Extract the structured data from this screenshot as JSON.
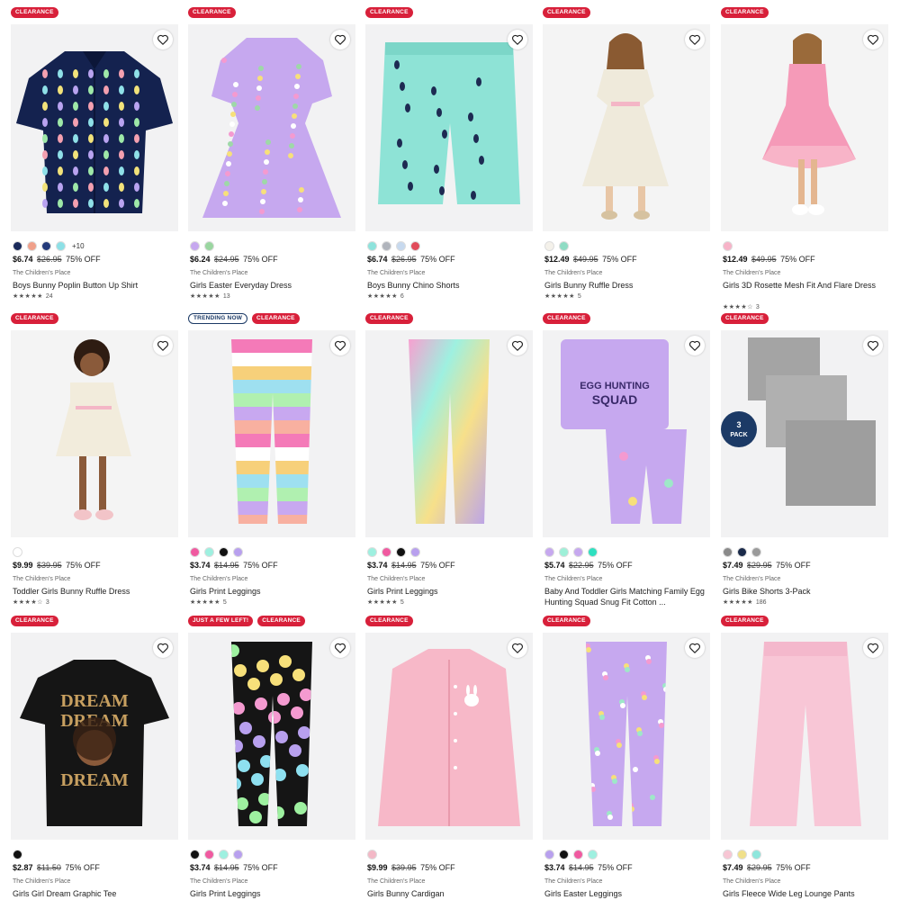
{
  "products": [
    {
      "badges": [
        {
          "type": "clearance",
          "label": "CLEARANCE"
        }
      ],
      "swatches": [
        "#1a2a5a",
        "#f0a08a",
        "#233a7a",
        "#8de0e6"
      ],
      "more": "+10",
      "price": "$6.74",
      "was": "$26.95",
      "off": "75% OFF",
      "brand": "The Children's Place",
      "name": "Boys Bunny Poplin Button Up Shirt",
      "stars": "★★★★★",
      "reviews": "24",
      "image": "navy-bunny-shirt"
    },
    {
      "badges": [
        {
          "type": "clearance",
          "label": "CLEARANCE"
        }
      ],
      "swatches": [
        "#c6a8ef",
        "#9ad6a0"
      ],
      "more": "",
      "price": "$6.24",
      "was": "$24.95",
      "off": "75% OFF",
      "brand": "The Children's Place",
      "name": "Girls Easter Everyday Dress",
      "stars": "★★★★★",
      "reviews": "13",
      "image": "lavender-easter-dress"
    },
    {
      "badges": [
        {
          "type": "clearance",
          "label": "CLEARANCE"
        }
      ],
      "swatches": [
        "#8ee3dc",
        "#b0b4bc",
        "#c7d9ee",
        "#e14b5a"
      ],
      "more": "",
      "price": "$6.74",
      "was": "$26.95",
      "off": "75% OFF",
      "brand": "The Children's Place",
      "name": "Boys Bunny Chino Shorts",
      "stars": "★★★★★",
      "reviews": "6",
      "image": "mint-bunny-shorts"
    },
    {
      "badges": [
        {
          "type": "clearance",
          "label": "CLEARANCE"
        }
      ],
      "swatches": [
        "#f4f1ea",
        "#8fdcc4"
      ],
      "more": "",
      "price": "$12.49",
      "was": "$49.95",
      "off": "75% OFF",
      "brand": "The Children's Place",
      "name": "Girls Bunny Ruffle Dress",
      "stars": "★★★★★",
      "reviews": "5",
      "image": "bunny-ruffle-dress"
    },
    {
      "badges": [
        {
          "type": "clearance",
          "label": "CLEARANCE"
        }
      ],
      "swatches": [
        "#f7b3c8"
      ],
      "more": "",
      "price": "$12.49",
      "was": "$49.95",
      "off": "75% OFF",
      "brand": "The Children's Place",
      "name": "Girls 3D Rosette Mesh Fit And Flare Dress",
      "stars": "★★★★☆",
      "reviews": "3",
      "image": "pink-rosette-dress"
    },
    {
      "badges": [
        {
          "type": "clearance",
          "label": "CLEARANCE"
        }
      ],
      "swatches": [
        "#ffffff"
      ],
      "more": "",
      "price": "$9.99",
      "was": "$39.95",
      "off": "75% OFF",
      "brand": "The Children's Place",
      "name": "Toddler Girls Bunny Ruffle Dress",
      "stars": "★★★★☆",
      "reviews": "3",
      "image": "toddler-ruffle-dress"
    },
    {
      "badges": [
        {
          "type": "trending",
          "label": "TRENDING NOW"
        },
        {
          "type": "clearance",
          "label": "CLEARANCE"
        }
      ],
      "swatches": [
        "#f05aa0",
        "#9ef0e0",
        "#111111",
        "#b8a0ee"
      ],
      "more": "",
      "price": "$3.74",
      "was": "$14.95",
      "off": "75% OFF",
      "brand": "The Children's Place",
      "name": "Girls Print Leggings",
      "stars": "★★★★★",
      "reviews": "5",
      "image": "rainbow-stripe-leggings"
    },
    {
      "badges": [
        {
          "type": "clearance",
          "label": "CLEARANCE"
        }
      ],
      "swatches": [
        "#9ef0e0",
        "#f05aa0",
        "#111111",
        "#b8a0ee"
      ],
      "more": "",
      "price": "$3.74",
      "was": "$14.95",
      "off": "75% OFF",
      "brand": "The Children's Place",
      "name": "Girls Print Leggings",
      "stars": "★★★★★",
      "reviews": "5",
      "image": "tie-dye-leggings"
    },
    {
      "badges": [
        {
          "type": "clearance",
          "label": "CLEARANCE"
        }
      ],
      "swatches": [
        "#c6a8ef",
        "#9ef0d8",
        "#c6a8ef",
        "#2ee0c0"
      ],
      "more": "",
      "price": "$5.74",
      "was": "$22.95",
      "off": "75% OFF",
      "brand": "The Children's Place",
      "name": "Baby And Toddler Girls Matching Family Egg Hunting Squad Snug Fit Cotton ...",
      "stars": "",
      "reviews": "",
      "image": "egg-hunting-pajamas"
    },
    {
      "badges": [
        {
          "type": "clearance",
          "label": "CLEARANCE"
        }
      ],
      "swatches": [
        "#8a8a8a",
        "#1a2a4a",
        "#9a9a9a"
      ],
      "more": "",
      "price": "$7.49",
      "was": "$29.95",
      "off": "75% OFF",
      "brand": "The Children's Place",
      "name": "Girls Bike Shorts 3-Pack",
      "stars": "★★★★★",
      "reviews": "186",
      "image": "gray-bike-shorts",
      "pack": "3 PACK"
    },
    {
      "badges": [
        {
          "type": "clearance",
          "label": "CLEARANCE"
        }
      ],
      "swatches": [
        "#111111"
      ],
      "more": "",
      "price": "$2.87",
      "was": "$11.50",
      "off": "75% OFF",
      "brand": "The Children's Place",
      "name": "Girls Girl Dream Graphic Tee",
      "stars": "",
      "reviews": "",
      "image": "dream-tee",
      "tee_text": "DREAM"
    },
    {
      "badges": [
        {
          "type": "fewleft",
          "label": "JUST A FEW LEFT!"
        },
        {
          "type": "clearance",
          "label": "CLEARANCE"
        }
      ],
      "swatches": [
        "#111111",
        "#f05aa0",
        "#9ef0e0",
        "#b8a0ee"
      ],
      "more": "",
      "price": "$3.74",
      "was": "$14.95",
      "off": "75% OFF",
      "brand": "The Children's Place",
      "name": "Girls Print Leggings",
      "stars": "",
      "reviews": "",
      "image": "peace-smiley-leggings"
    },
    {
      "badges": [
        {
          "type": "clearance",
          "label": "CLEARANCE"
        }
      ],
      "swatches": [
        "#f3b8c6"
      ],
      "more": "",
      "price": "$9.99",
      "was": "$39.95",
      "off": "75% OFF",
      "brand": "The Children's Place",
      "name": "Girls Bunny Cardigan",
      "stars": "",
      "reviews": "",
      "image": "pink-cardigan"
    },
    {
      "badges": [
        {
          "type": "clearance",
          "label": "CLEARANCE"
        }
      ],
      "swatches": [
        "#b8a0ee",
        "#111111",
        "#f05aa0",
        "#9ef0e0"
      ],
      "more": "",
      "price": "$3.74",
      "was": "$14.95",
      "off": "75% OFF",
      "brand": "The Children's Place",
      "name": "Girls Easter Leggings",
      "stars": "",
      "reviews": "",
      "image": "easter-leggings"
    },
    {
      "badges": [
        {
          "type": "clearance",
          "label": "CLEARANCE"
        }
      ],
      "swatches": [
        "#f7c6d4",
        "#f0e08a",
        "#8ee6dc"
      ],
      "more": "",
      "price": "$7.49",
      "was": "$29.95",
      "off": "75% OFF",
      "brand": "The Children's Place",
      "name": "Girls Fleece Wide Leg Lounge Pants",
      "stars": "",
      "reviews": "",
      "image": "pink-lounge-pants"
    }
  ]
}
